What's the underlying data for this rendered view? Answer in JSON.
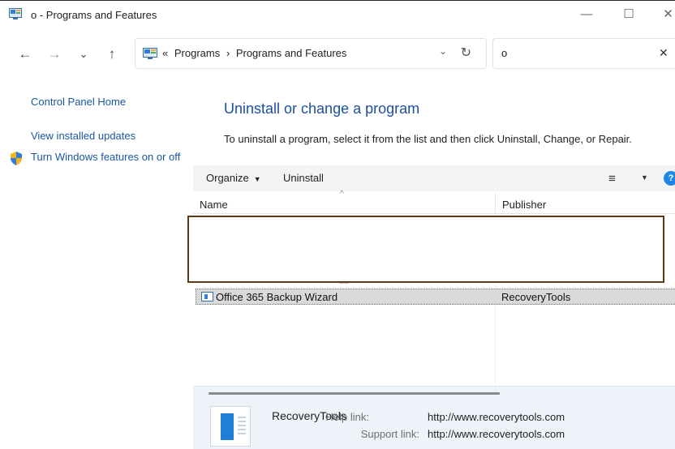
{
  "window": {
    "title": "o - Programs and Features",
    "minimize_glyph": "—",
    "maximize_glyph": "☐",
    "close_glyph": "✕"
  },
  "nav": {
    "back_glyph": "←",
    "forward_glyph": "→",
    "recent_glyph": "⌄",
    "up_glyph": "↑"
  },
  "addressbar": {
    "overflow": "«",
    "crumbs": [
      "Programs",
      "Programs and Features"
    ],
    "separator": "›",
    "dropdown_glyph": "⌄",
    "refresh_glyph": "↻"
  },
  "search": {
    "value": "o",
    "clear_glyph": "✕"
  },
  "sidebar": {
    "links": [
      "Control Panel Home",
      "View installed updates",
      "Turn Windows features on or off"
    ]
  },
  "main": {
    "title": "Uninstall or change a program",
    "description": "To uninstall a program, select it from the list and then click Uninstall, Change, or Repair."
  },
  "toolbar": {
    "organize_label": "Organize",
    "uninstall_label": "Uninstall",
    "caret": "▼",
    "view_glyph": "≡",
    "help_glyph": "?"
  },
  "columns": {
    "name": "Name",
    "publisher": "Publisher",
    "sort_glyph": "^"
  },
  "programs": [
    {
      "name": "Office 365 Backup Wizard",
      "publisher": "RecoveryTools"
    }
  ],
  "details": {
    "publisher": "RecoveryTools",
    "help_link_label": "Help link:",
    "help_link": "http://www.recoverytools.com",
    "support_link_label": "Support link:",
    "support_link": "http://www.recoverytools.com"
  },
  "colors": {
    "link": "#1a57a3",
    "title": "#1c4f9c",
    "selection": "#d9d9d9",
    "details_bg": "#eef3fa",
    "overlay_border": "#5a3b12"
  },
  "icons": [
    "control-panel-icon",
    "shield-icon",
    "program-icon",
    "help-icon"
  ]
}
